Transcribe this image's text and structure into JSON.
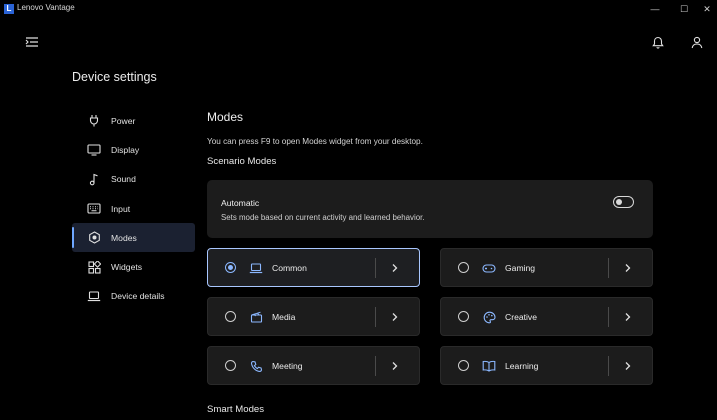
{
  "window": {
    "logo_letter": "L",
    "title": "Lenovo Vantage",
    "minimize_glyph": "—",
    "maximize_glyph": "☐",
    "close_glyph": "✕"
  },
  "topbar": {
    "menu_icon": "collapse-menu-icon",
    "notifications_icon": "bell-icon",
    "account_icon": "user-icon"
  },
  "sidebar": {
    "title": "Device settings",
    "items": [
      {
        "label": "Power",
        "icon": "plug-icon"
      },
      {
        "label": "Display",
        "icon": "monitor-icon"
      },
      {
        "label": "Sound",
        "icon": "music-note-icon"
      },
      {
        "label": "Input",
        "icon": "keyboard-icon"
      },
      {
        "label": "Modes",
        "icon": "modes-icon",
        "active": true
      },
      {
        "label": "Widgets",
        "icon": "widgets-icon"
      },
      {
        "label": "Device details",
        "icon": "laptop-icon"
      }
    ]
  },
  "main": {
    "heading": "Modes",
    "description": "You can press F9 to open Modes widget from your desktop.",
    "scenario_heading": "Scenario Modes",
    "automatic": {
      "title": "Automatic",
      "description": "Sets mode based on current activity and learned behavior.",
      "enabled": false
    },
    "modes": [
      {
        "label": "Common",
        "icon": "laptop-icon",
        "selected": true
      },
      {
        "label": "Gaming",
        "icon": "gamepad-icon",
        "selected": false
      },
      {
        "label": "Media",
        "icon": "clapperboard-icon",
        "selected": false
      },
      {
        "label": "Creative",
        "icon": "palette-icon",
        "selected": false
      },
      {
        "label": "Meeting",
        "icon": "phone-icon",
        "selected": false
      },
      {
        "label": "Learning",
        "icon": "book-icon",
        "selected": false
      }
    ],
    "smart_heading": "Smart Modes"
  },
  "colors": {
    "background": "#000000",
    "card": "#1c1c1c",
    "accent": "#8cb8ff",
    "active_nav": "#1b2131"
  }
}
